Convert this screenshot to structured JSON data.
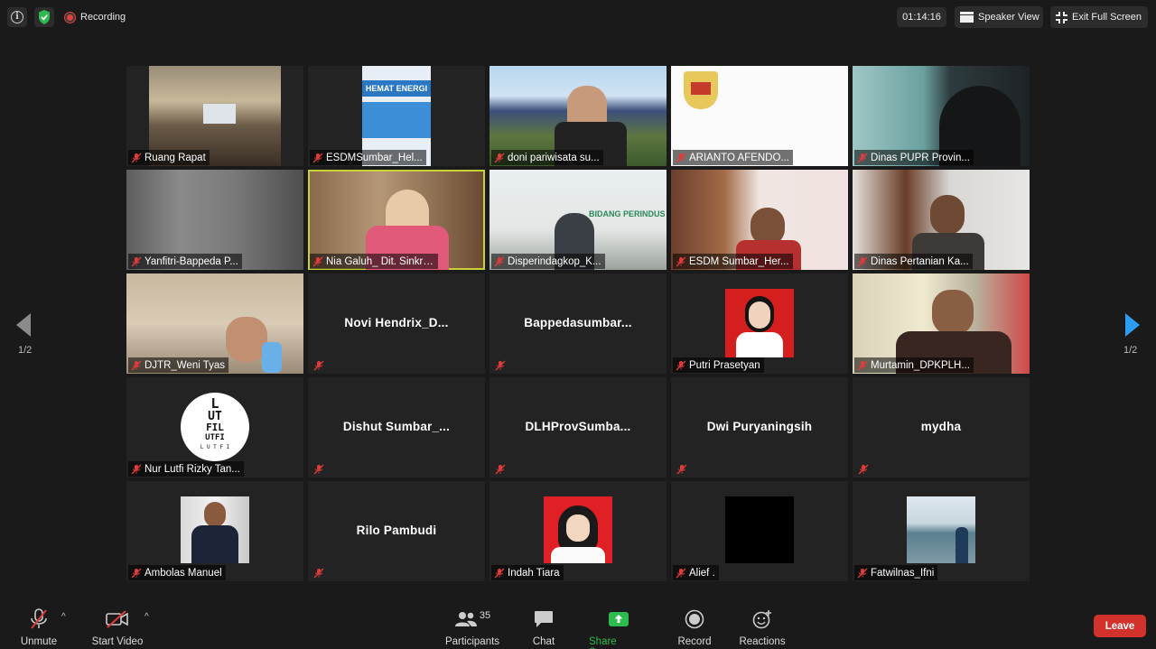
{
  "topbar": {
    "recording_label": "Recording",
    "timer": "01:14:16",
    "speaker_view_label": "Speaker View",
    "exit_fullscreen_label": "Exit Full Screen"
  },
  "pagination": {
    "left": "1/2",
    "right": "1/2"
  },
  "tiles": [
    {
      "name": "Ruang Rapat",
      "video": true
    },
    {
      "name": "ESDMSumbar_Hel...",
      "video": true
    },
    {
      "name": "doni pariwisata su...",
      "video": true
    },
    {
      "name": "ARIANTO AFENDO...",
      "video": true
    },
    {
      "name": "Dinas PUPR Provin...",
      "video": true
    },
    {
      "name": "Yanfitri-Bappeda P...",
      "video": true
    },
    {
      "name": "Nia Galuh_ Dit. Sinkro...",
      "video": true,
      "active": true
    },
    {
      "name": "Disperindagkop_K...",
      "video": true
    },
    {
      "name": "ESDM Sumbar_Her...",
      "video": true
    },
    {
      "name": "Dinas Pertanian Ka...",
      "video": true
    },
    {
      "name": "DJTR_Weni Tyas",
      "video": true
    },
    {
      "name": "Novi  Hendrix_D...",
      "video": false
    },
    {
      "name": "Bappedasumbar...",
      "video": false
    },
    {
      "name": "Putri Prasetyan",
      "video": false,
      "photo": true
    },
    {
      "name": "Murtamin_DPKPLH...",
      "video": true
    },
    {
      "name": "Nur Lutfi Rizky Tan...",
      "video": false,
      "photo": true
    },
    {
      "name": "Dishut  Sumbar_...",
      "video": false
    },
    {
      "name": "DLHProvSumba...",
      "video": false
    },
    {
      "name": "Dwi Puryaningsih",
      "video": false
    },
    {
      "name": "mydha",
      "video": false
    },
    {
      "name": "Ambolas Manuel",
      "video": false,
      "photo": true
    },
    {
      "name": "Rilo Pambudi",
      "video": false
    },
    {
      "name": "Indah Tiara",
      "video": false,
      "photo": true
    },
    {
      "name": "Alief .",
      "video": false,
      "photo": true
    },
    {
      "name": "Fatwilnas_Ifni",
      "video": false,
      "photo": true
    }
  ],
  "lutfi_logo": {
    "line1": "L",
    "line2": "UT",
    "line3": "FIL",
    "line4": "UTFI",
    "line5": "L U T F I"
  },
  "esdm_slide": {
    "text": "HEMAT ENERGI"
  },
  "disperindag_bg": {
    "text": "BIDANG PERINDUS"
  },
  "toolbar": {
    "unmute": "Unmute",
    "start_video": "Start Video",
    "participants": "Participants",
    "participants_count": "35",
    "chat": "Chat",
    "share_screen": "Share Screen",
    "record": "Record",
    "reactions": "Reactions",
    "leave": "Leave"
  },
  "colors": {
    "accent_green": "#2dba4e",
    "leave_red": "#d3322c",
    "active_border": "#c7d13a",
    "nav_blue": "#2d9cf0",
    "mic_muted_red": "#e03b3b"
  }
}
